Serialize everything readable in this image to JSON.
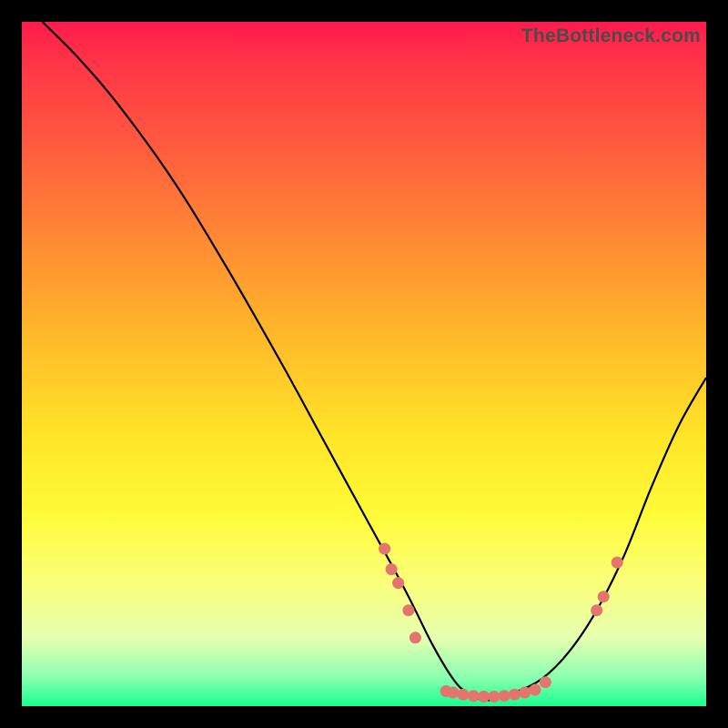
{
  "watermark": "TheBottleneck.com",
  "chart_data": {
    "type": "line",
    "title": "",
    "xlabel": "",
    "ylabel": "",
    "xlim": [
      0,
      100
    ],
    "ylim": [
      0,
      100
    ],
    "grid": false,
    "legend": false,
    "axes_visible": false,
    "background_gradient": [
      "#ff1a4d",
      "#ff3547",
      "#ff5a3f",
      "#ff8a33",
      "#ffb92a",
      "#ffe327",
      "#fffb38",
      "#faff7a",
      "#e6ffb0",
      "#86ffb0",
      "#19ff8f"
    ],
    "series": [
      {
        "name": "bottleneck-curve",
        "x": [
          3,
          8,
          14,
          22,
          30,
          38,
          44,
          50,
          56,
          60,
          63,
          65,
          67,
          69,
          72,
          76,
          80,
          84,
          88,
          92,
          96,
          100
        ],
        "y": [
          100,
          95,
          88,
          77,
          64,
          50,
          39,
          28,
          17,
          9,
          4,
          2,
          1,
          1,
          2,
          4,
          8,
          14,
          22,
          32,
          41,
          48
        ]
      }
    ],
    "scatter_points": {
      "name": "highlighted-points",
      "color": "#e3756e",
      "points": [
        {
          "x": 53,
          "y": 23
        },
        {
          "x": 54,
          "y": 20
        },
        {
          "x": 55,
          "y": 18
        },
        {
          "x": 56.5,
          "y": 14
        },
        {
          "x": 57.5,
          "y": 10
        },
        {
          "x": 62,
          "y": 2.2
        },
        {
          "x": 63,
          "y": 2.0
        },
        {
          "x": 64.5,
          "y": 1.7
        },
        {
          "x": 66,
          "y": 1.5
        },
        {
          "x": 67.5,
          "y": 1.4
        },
        {
          "x": 69,
          "y": 1.4
        },
        {
          "x": 70.5,
          "y": 1.5
        },
        {
          "x": 72,
          "y": 1.7
        },
        {
          "x": 73.5,
          "y": 2.0
        },
        {
          "x": 75,
          "y": 2.4
        },
        {
          "x": 76.5,
          "y": 3.5
        },
        {
          "x": 84,
          "y": 14
        },
        {
          "x": 85,
          "y": 16
        },
        {
          "x": 87,
          "y": 21
        }
      ]
    }
  }
}
